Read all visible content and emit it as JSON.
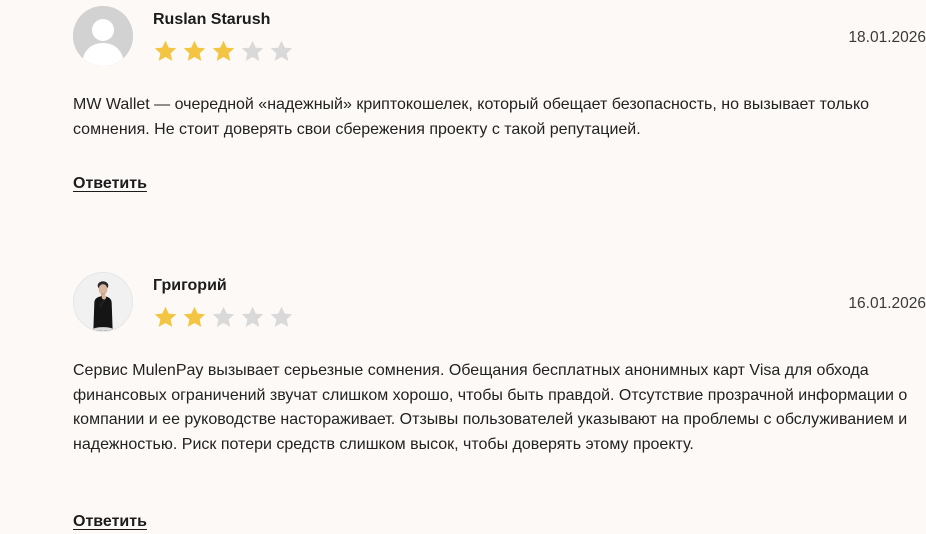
{
  "reviews": [
    {
      "author": "Ruslan Starush",
      "date": "18.01.2026",
      "rating": 3,
      "max_rating": 5,
      "avatar": "default-user-avatar",
      "text": "MW Wallet — очередной «надежный» криптокошелек, который обещает безопасность, но вызывает только сомнения. Не стоит доверять свои сбережения проекту с такой репутацией.",
      "reply_label": "Ответить"
    },
    {
      "author": "Григорий",
      "date": "16.01.2026",
      "rating": 2,
      "max_rating": 5,
      "avatar": "user-photo-avatar",
      "text": "Сервис MulenPay вызывает серьезные сомнения. Обещания бесплатных анонимных карт Visa для обхода финансовых ограничений звучат слишком хорошо, чтобы быть правдой. Отсутствие прозрачной информации о компании и ее руководстве настораживает. Отзывы пользователей указывают на проблемы с обслуживанием и надежностью. Риск потери средств слишком высок, чтобы доверять этому проекту.",
      "reply_label": "Ответить"
    }
  ],
  "colors": {
    "background": "#fdf9f6",
    "star_filled": "#f4c542",
    "star_empty": "#d9d9d9",
    "text": "#1c1c1c"
  },
  "icons": {
    "star": "star-icon"
  }
}
